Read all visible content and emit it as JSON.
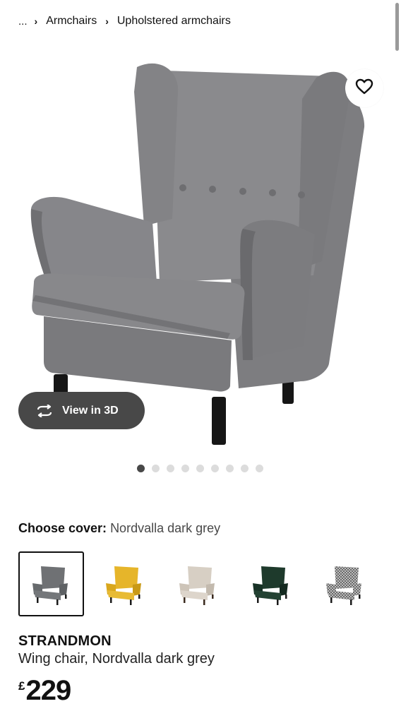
{
  "breadcrumb": {
    "ellipsis": "...",
    "items": [
      "Armchairs",
      "Upholstered armchairs"
    ],
    "separator": "›"
  },
  "image": {
    "view3d_label": "View in 3D",
    "favourite_icon": "heart-outline-icon",
    "view3d_icon": "rotate-3d-icon",
    "dot_count": 9,
    "active_dot": 0
  },
  "cover": {
    "label": "Choose cover:",
    "value": "Nordvalla dark grey",
    "options": [
      {
        "color": "#6f7174",
        "selected": true
      },
      {
        "color": "#e6b52a",
        "selected": false
      },
      {
        "color": "#d7cfc4",
        "selected": false
      },
      {
        "color": "#1e3a2c",
        "selected": false
      },
      {
        "color": "#9c9c9c",
        "selected": false
      }
    ]
  },
  "product": {
    "name": "STRANDMON",
    "description": "Wing chair, Nordvalla dark grey",
    "currency": "£",
    "price": "229"
  },
  "colors": {
    "text": "#111111",
    "button_dark": "#484848",
    "dot_inactive": "#dcdcdc"
  }
}
